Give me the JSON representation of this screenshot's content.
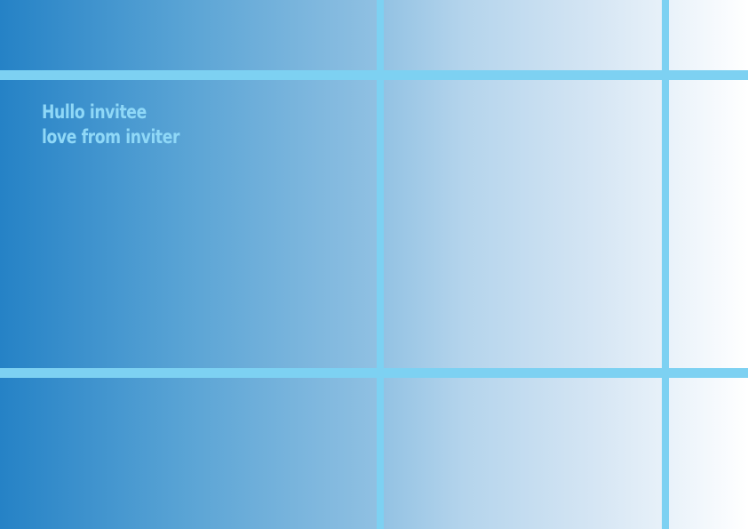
{
  "card": {
    "greeting_line": "Hullo invitee",
    "signoff_line": "love from inviter"
  },
  "colors": {
    "gradient_start": "#2582c6",
    "gradient_end": "#ffffff",
    "grid_line": "#7dd1f2",
    "text": "#8fd8f7"
  }
}
